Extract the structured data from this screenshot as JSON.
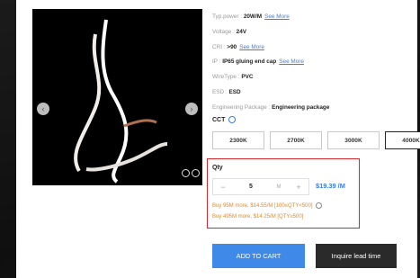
{
  "specs": [
    {
      "label": "Typ.power : ",
      "value": "20W/M",
      "link": "See More"
    },
    {
      "label": "Voltage : ",
      "value": "24V",
      "link": ""
    },
    {
      "label": "CRI : ",
      "value": ">90",
      "link": "See More"
    },
    {
      "label": "IP : ",
      "value": "IP65 gluing end cap",
      "link": "See More"
    },
    {
      "label": "WireType : ",
      "value": "PVC",
      "link": ""
    },
    {
      "label": "ESD : ",
      "value": "ESD",
      "link": ""
    },
    {
      "label": "Engineering Package : ",
      "value": "Engineering package",
      "link": ""
    }
  ],
  "cct": {
    "label": "CCT",
    "options": [
      "2300K",
      "2700K",
      "3000K",
      "4000K"
    ],
    "selected": "4000K"
  },
  "qty": {
    "label": "Qty",
    "minus": "−",
    "value": "5",
    "unit": "M",
    "plus": "+",
    "price": "$19.39 /M",
    "tiers": [
      "Buy 95M more, $14.55/M [100≤QTY<500]",
      "Buy 495M more, $14.25/M [QTY≥500]"
    ]
  },
  "actions": {
    "add_to_cart": "ADD TO CART",
    "inquire": "Inquire lead time"
  },
  "colors": {
    "accent": "#3f8ae8",
    "qty_border": "#d7272b",
    "tier_text": "#e08a2b",
    "price": "#3a7de0"
  }
}
